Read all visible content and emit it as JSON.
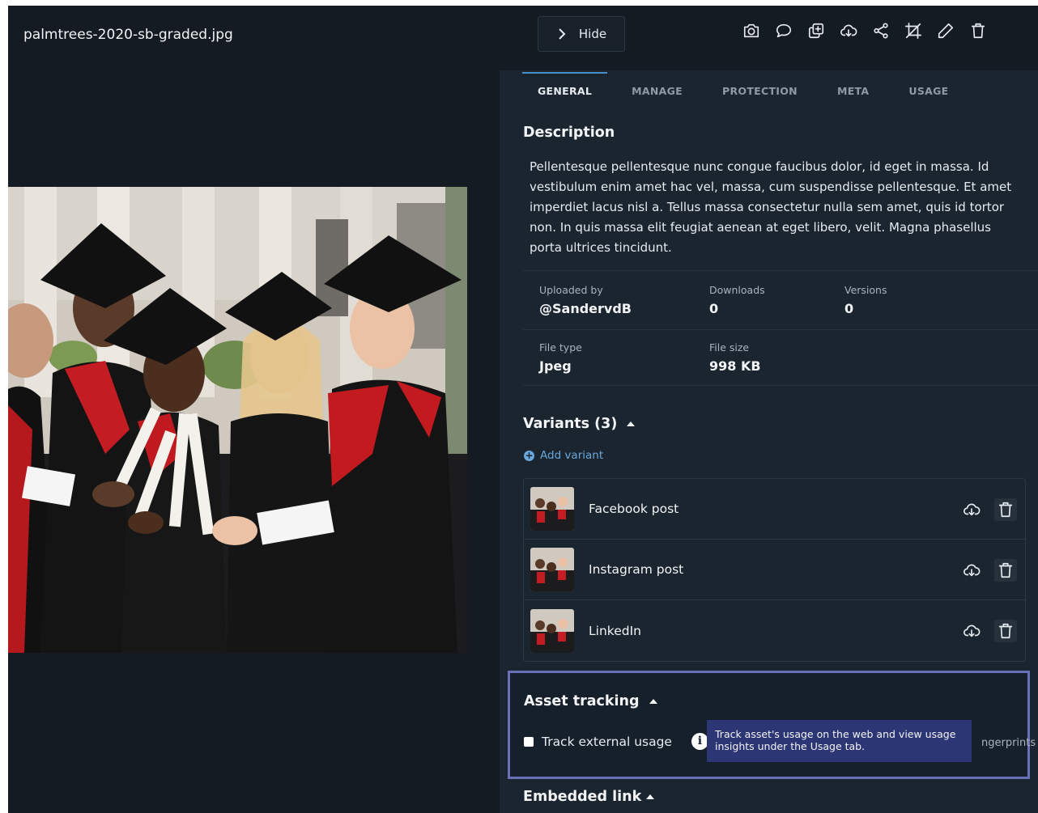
{
  "file": {
    "name": "palmtrees-2020-sb-graded.jpg"
  },
  "topbar": {
    "hide_label": "Hide",
    "tools": [
      {
        "icon": "camera-icon"
      },
      {
        "icon": "comment-icon"
      },
      {
        "icon": "duplicate-icon"
      },
      {
        "icon": "cloud-download-icon"
      },
      {
        "icon": "share-icon"
      },
      {
        "icon": "crop-icon"
      },
      {
        "icon": "pencil-icon"
      },
      {
        "icon": "trash-icon"
      }
    ]
  },
  "tabs": [
    {
      "label": "GENERAL",
      "active": true
    },
    {
      "label": "MANAGE",
      "active": false
    },
    {
      "label": "PROTECTION",
      "active": false
    },
    {
      "label": "META",
      "active": false
    },
    {
      "label": "USAGE",
      "active": false
    }
  ],
  "description": {
    "title": "Description",
    "text": "Pellentesque pellentesque nunc congue faucibus dolor, id eget in massa. Id vestibulum enim amet hac vel, massa, cum suspendisse pellentesque. Et amet imperdiet lacus nisl a. Tellus massa consectetur nulla sem amet, quis id tortor non. In quis massa elit feugiat aenean at eget libero, velit. Magna phasellus porta ultrices tincidunt."
  },
  "meta": {
    "uploaded_by_label": "Uploaded by",
    "uploaded_by_value": "@SandervdB",
    "downloads_label": "Downloads",
    "downloads_value": "0",
    "versions_label": "Versions",
    "versions_value": "0",
    "file_type_label": "File type",
    "file_type_value": "Jpeg",
    "file_size_label": "File size",
    "file_size_value": "998 KB"
  },
  "variants": {
    "title": "Variants (3)",
    "add_label": "Add variant",
    "items": [
      {
        "name": "Facebook post"
      },
      {
        "name": "Instagram post"
      },
      {
        "name": "LinkedIn"
      }
    ]
  },
  "asset_tracking": {
    "title": "Asset tracking",
    "checkbox_label": "Track external usage",
    "checked": false,
    "tooltip": "Track asset's usage on the web and view usage insights under the Usage tab.",
    "truncated_text": "ngerprints"
  },
  "embedded_link": {
    "title": "Embedded link"
  },
  "colors": {
    "panel_bg": "#1b252f",
    "dark_bg": "#141b22",
    "accent": "#4a90c8",
    "link": "#6aa8dc",
    "highlight_border": "#6b6fb8",
    "tooltip_bg": "#2d3674"
  }
}
